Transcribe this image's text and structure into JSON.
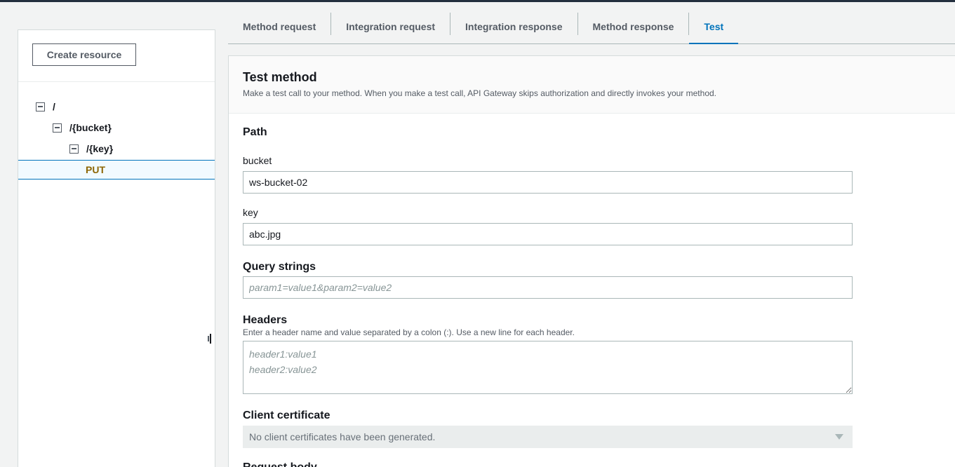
{
  "left": {
    "create_label": "Create resource",
    "tree": [
      {
        "label": "/"
      },
      {
        "label": "/{bucket}"
      },
      {
        "label": "/{key}"
      }
    ],
    "method": "PUT"
  },
  "tabs": [
    {
      "label": "Method request"
    },
    {
      "label": "Integration request"
    },
    {
      "label": "Integration response"
    },
    {
      "label": "Method response"
    },
    {
      "label": "Test"
    }
  ],
  "test": {
    "title": "Test method",
    "description": "Make a test call to your method. When you make a test call, API Gateway skips authorization and directly invokes your method.",
    "path_title": "Path",
    "bucket_label": "bucket",
    "bucket_value": "ws-bucket-02",
    "key_label": "key",
    "key_value": "abc.jpg",
    "query_title": "Query strings",
    "query_placeholder": "param1=value1&param2=value2",
    "headers_title": "Headers",
    "headers_hint": "Enter a header name and value separated by a colon (:). Use a new line for each header.",
    "headers_placeholder": "header1:value1\nheader2:value2",
    "client_cert_title": "Client certificate",
    "client_cert_value": "No client certificates have been generated.",
    "request_body_title": "Request body"
  }
}
